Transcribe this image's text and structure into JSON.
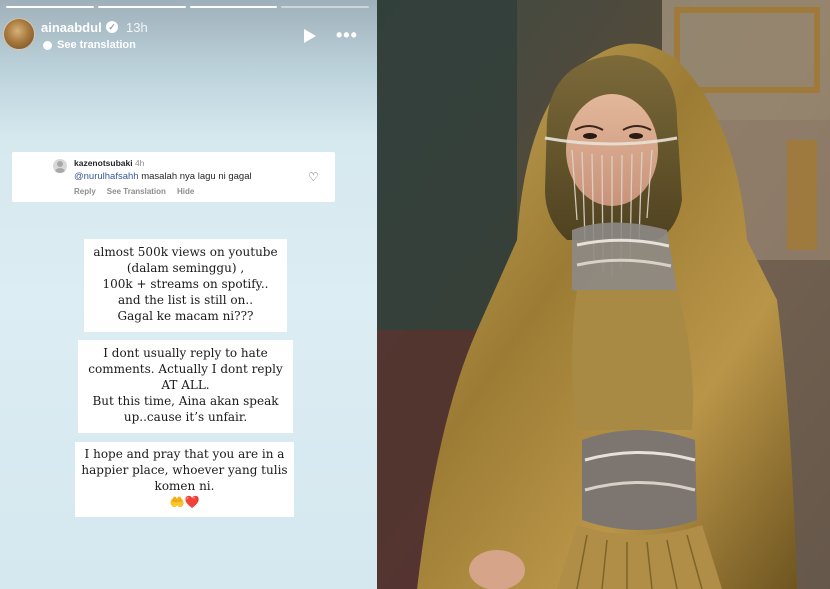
{
  "story": {
    "progress_segments": 4,
    "progress_completed": 3,
    "username": "ainaabdul",
    "verified_icon": "verified-badge-icon",
    "time_ago": "13h",
    "see_translation": "See translation",
    "controls": {
      "play_icon": "play-icon",
      "more_icon": "more-options-icon"
    }
  },
  "comment": {
    "username": "kazenotsubaki",
    "time_ago": "4h",
    "mention": "@nurulhafsahh",
    "text": "masalah nya lagu ni gagal",
    "actions": [
      "Reply",
      "See Translation",
      "Hide"
    ],
    "like_icon": "heart-icon"
  },
  "text_boxes": [
    {
      "lines": [
        "almost 500k views on youtube",
        "(dalam seminggu) ,",
        "100k + streams on spotify..",
        "and the list is still on..",
        "Gagal ke macam ni???"
      ]
    },
    {
      "lines": [
        "I dont usually reply to hate",
        "comments. Actually I dont reply",
        "AT ALL.",
        "But this time, Aina akan speak",
        "up..cause it’s unfair."
      ]
    },
    {
      "lines": [
        "I hope and pray that you are in a",
        "happier place, whoever yang tulis",
        "komen ni.",
        "🤲❤️"
      ]
    }
  ],
  "photo": {
    "colors": {
      "gold": "#a88a3e",
      "shadow_gold": "#5e4a1a",
      "skin": "#d9a98a",
      "wall": "#3d4a44"
    }
  }
}
